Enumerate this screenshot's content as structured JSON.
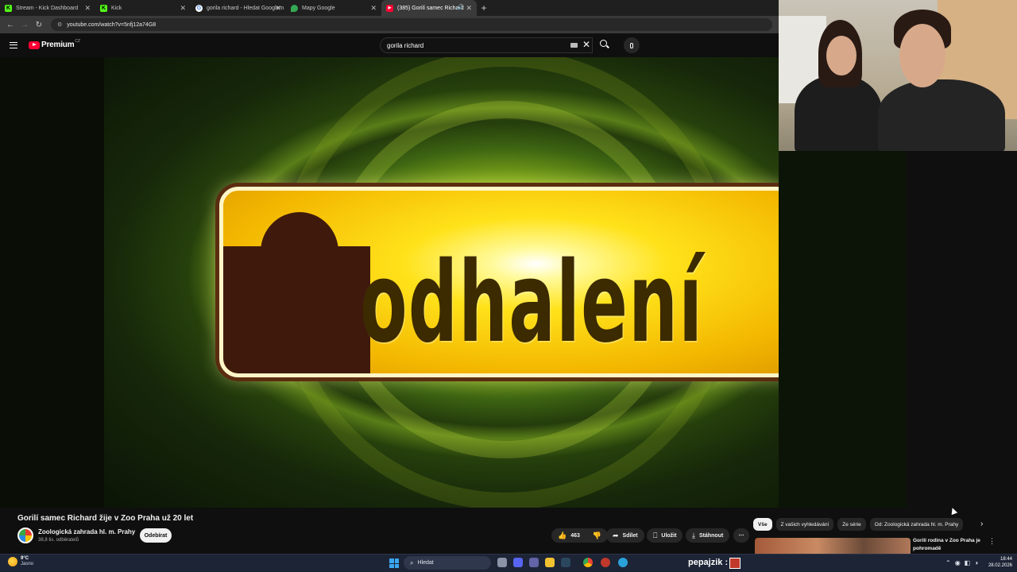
{
  "browser": {
    "tabs": [
      {
        "label": "Stream - Kick Dashboard",
        "favicon": "kick-icon",
        "color": "#53fc18"
      },
      {
        "label": "Kick",
        "favicon": "kick-icon",
        "color": "#53fc18"
      },
      {
        "label": "gorila richard - Hledat Googlem",
        "favicon": "google-icon",
        "color": "#4285f4"
      },
      {
        "label": "Mapy Google",
        "favicon": "maps-icon",
        "color": "#34a853"
      },
      {
        "label": "(385) Gorilí samec Richard",
        "favicon": "youtube-icon",
        "color": "#ff0033",
        "active": true
      }
    ],
    "url": "youtube.com/watch?v=5nfj12a74G8"
  },
  "youtube": {
    "logo_text": "Premium",
    "country_code": "CZ",
    "search_query": "gorila richard"
  },
  "video": {
    "logo_word": "odhalení",
    "title": "Gorilí samec Richard žije v Zoo Praha už 20 let",
    "channel": "Zoologická zahrada hl. m. Prahy",
    "subscribers": "38,8 tis. odběratelů",
    "subscribe_label": "Odebírat",
    "likes": "463",
    "share_label": "Sdílet",
    "save_label": "Uložit",
    "download_label": "Stáhnout"
  },
  "chips": [
    "Vše",
    "Z vašich vyhledávání",
    "Ze série",
    "Od: Zoologická zahrada hl. m. Prahy"
  ],
  "recommendation": {
    "title": "Gorilí rodina v Zoo Praha je pohromadě"
  },
  "taskbar": {
    "weather_temp": "9°C",
    "weather_desc": "Jasno",
    "search_label": "Hledat",
    "overlay_name": "pepajzik :",
    "time": "18:44",
    "date": "28.02.2026"
  },
  "colors": {
    "youtube_red": "#ff0033",
    "taskbar": "#1c2436",
    "accent_blue": "#3aa6f2"
  }
}
